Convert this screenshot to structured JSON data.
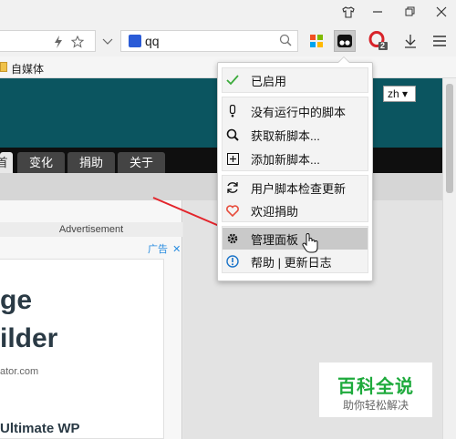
{
  "search": {
    "value": "qq"
  },
  "bookmarks": {
    "items": [
      {
        "label": "自媒体"
      }
    ]
  },
  "extensions": {
    "badge": "2"
  },
  "page": {
    "lang_selector": "zh ▾",
    "nav_tabs": [
      "首页",
      "变化",
      "捐助",
      "关于"
    ],
    "ad": {
      "header": "Advertisement",
      "choices_label": "广告",
      "headline_line1": "ge",
      "headline_line2": "ilder",
      "url": "ator.com",
      "subline": "Ultimate WP"
    }
  },
  "menu": {
    "items": [
      {
        "id": "enabled",
        "label": "已启用",
        "icon": "checkmark-icon"
      },
      {
        "id": "no-scripts",
        "label": "没有运行中的脚本",
        "icon": "exclamation-icon"
      },
      {
        "id": "get-scripts",
        "label": "获取新脚本...",
        "icon": "search-icon"
      },
      {
        "id": "new-script",
        "label": "添加新脚本...",
        "icon": "plus-box-icon"
      },
      {
        "id": "check-updates",
        "label": "用户脚本检查更新",
        "icon": "refresh-icon"
      },
      {
        "id": "donate",
        "label": "欢迎捐助",
        "icon": "heart-icon"
      },
      {
        "id": "dashboard",
        "label": "管理面板",
        "icon": "gear-icon",
        "hovered": true
      },
      {
        "id": "help",
        "label": "帮助 | 更新日志",
        "icon": "info-icon"
      }
    ]
  },
  "watermark": {
    "title": "百科全说",
    "subtitle": "助你轻松解决"
  },
  "colors": {
    "accent_green": "#3cab3c",
    "heart_red": "#e74c3c",
    "hero_teal": "#0b5560",
    "watermark_green": "#1eaa3c"
  }
}
